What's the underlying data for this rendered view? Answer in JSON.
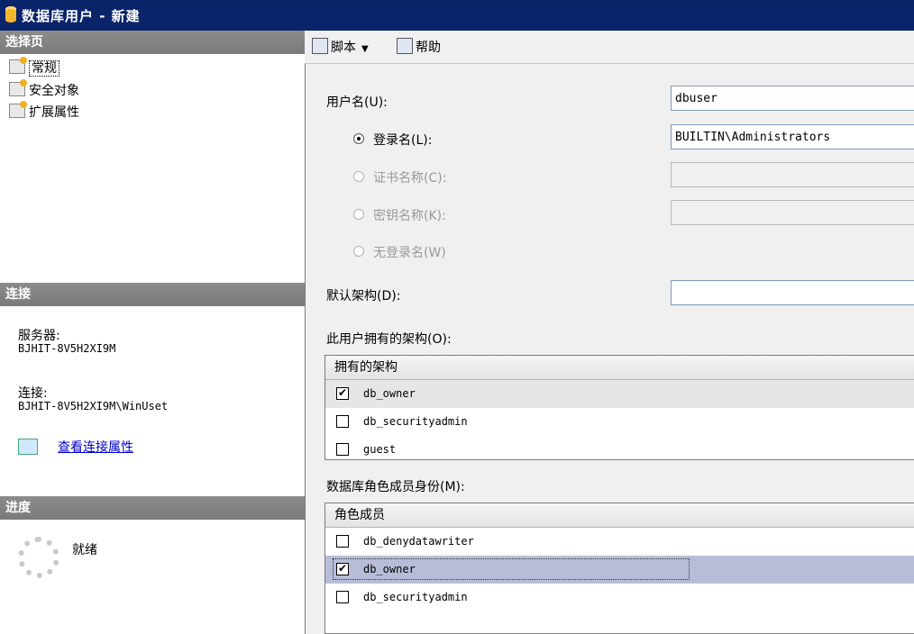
{
  "window": {
    "title": "数据库用户 - 新建"
  },
  "left": {
    "select_page_header": "选择页",
    "pages": [
      "常规",
      "安全对象",
      "扩展属性"
    ],
    "connection_header": "连接",
    "server_label": "服务器:",
    "server_value": "BJHIT-8V5H2XI9M",
    "connection_label": "连接:",
    "connection_value": "BJHIT-8V5H2XI9M\\WinUset",
    "view_link": "查看连接属性",
    "progress_header": "进度",
    "progress_status": "就绪"
  },
  "toolbar": {
    "script": "脚本",
    "help": "帮助"
  },
  "form": {
    "username_label": "用户名(U):",
    "username_value": "dbuser",
    "login_label": "登录名(L):",
    "login_value": "BUILTIN\\Administrators",
    "cert_label": "证书名称(C):",
    "key_label": "密钥名称(K):",
    "nologin_label": "无登录名(W)",
    "schema_label": "默认架构(D):",
    "schema_value": ""
  },
  "owned_schemas": {
    "label": "此用户拥有的架构(O):",
    "header": "拥有的架构",
    "rows": [
      {
        "name": "db_owner",
        "checked": true
      },
      {
        "name": "db_securityadmin",
        "checked": false
      },
      {
        "name": "guest",
        "checked": false
      }
    ]
  },
  "role_membership": {
    "label": "数据库角色成员身份(M):",
    "header": "角色成员",
    "rows": [
      {
        "name": "db_denydatawriter",
        "checked": false
      },
      {
        "name": "db_owner",
        "checked": true
      },
      {
        "name": "db_securityadmin",
        "checked": false
      }
    ]
  }
}
